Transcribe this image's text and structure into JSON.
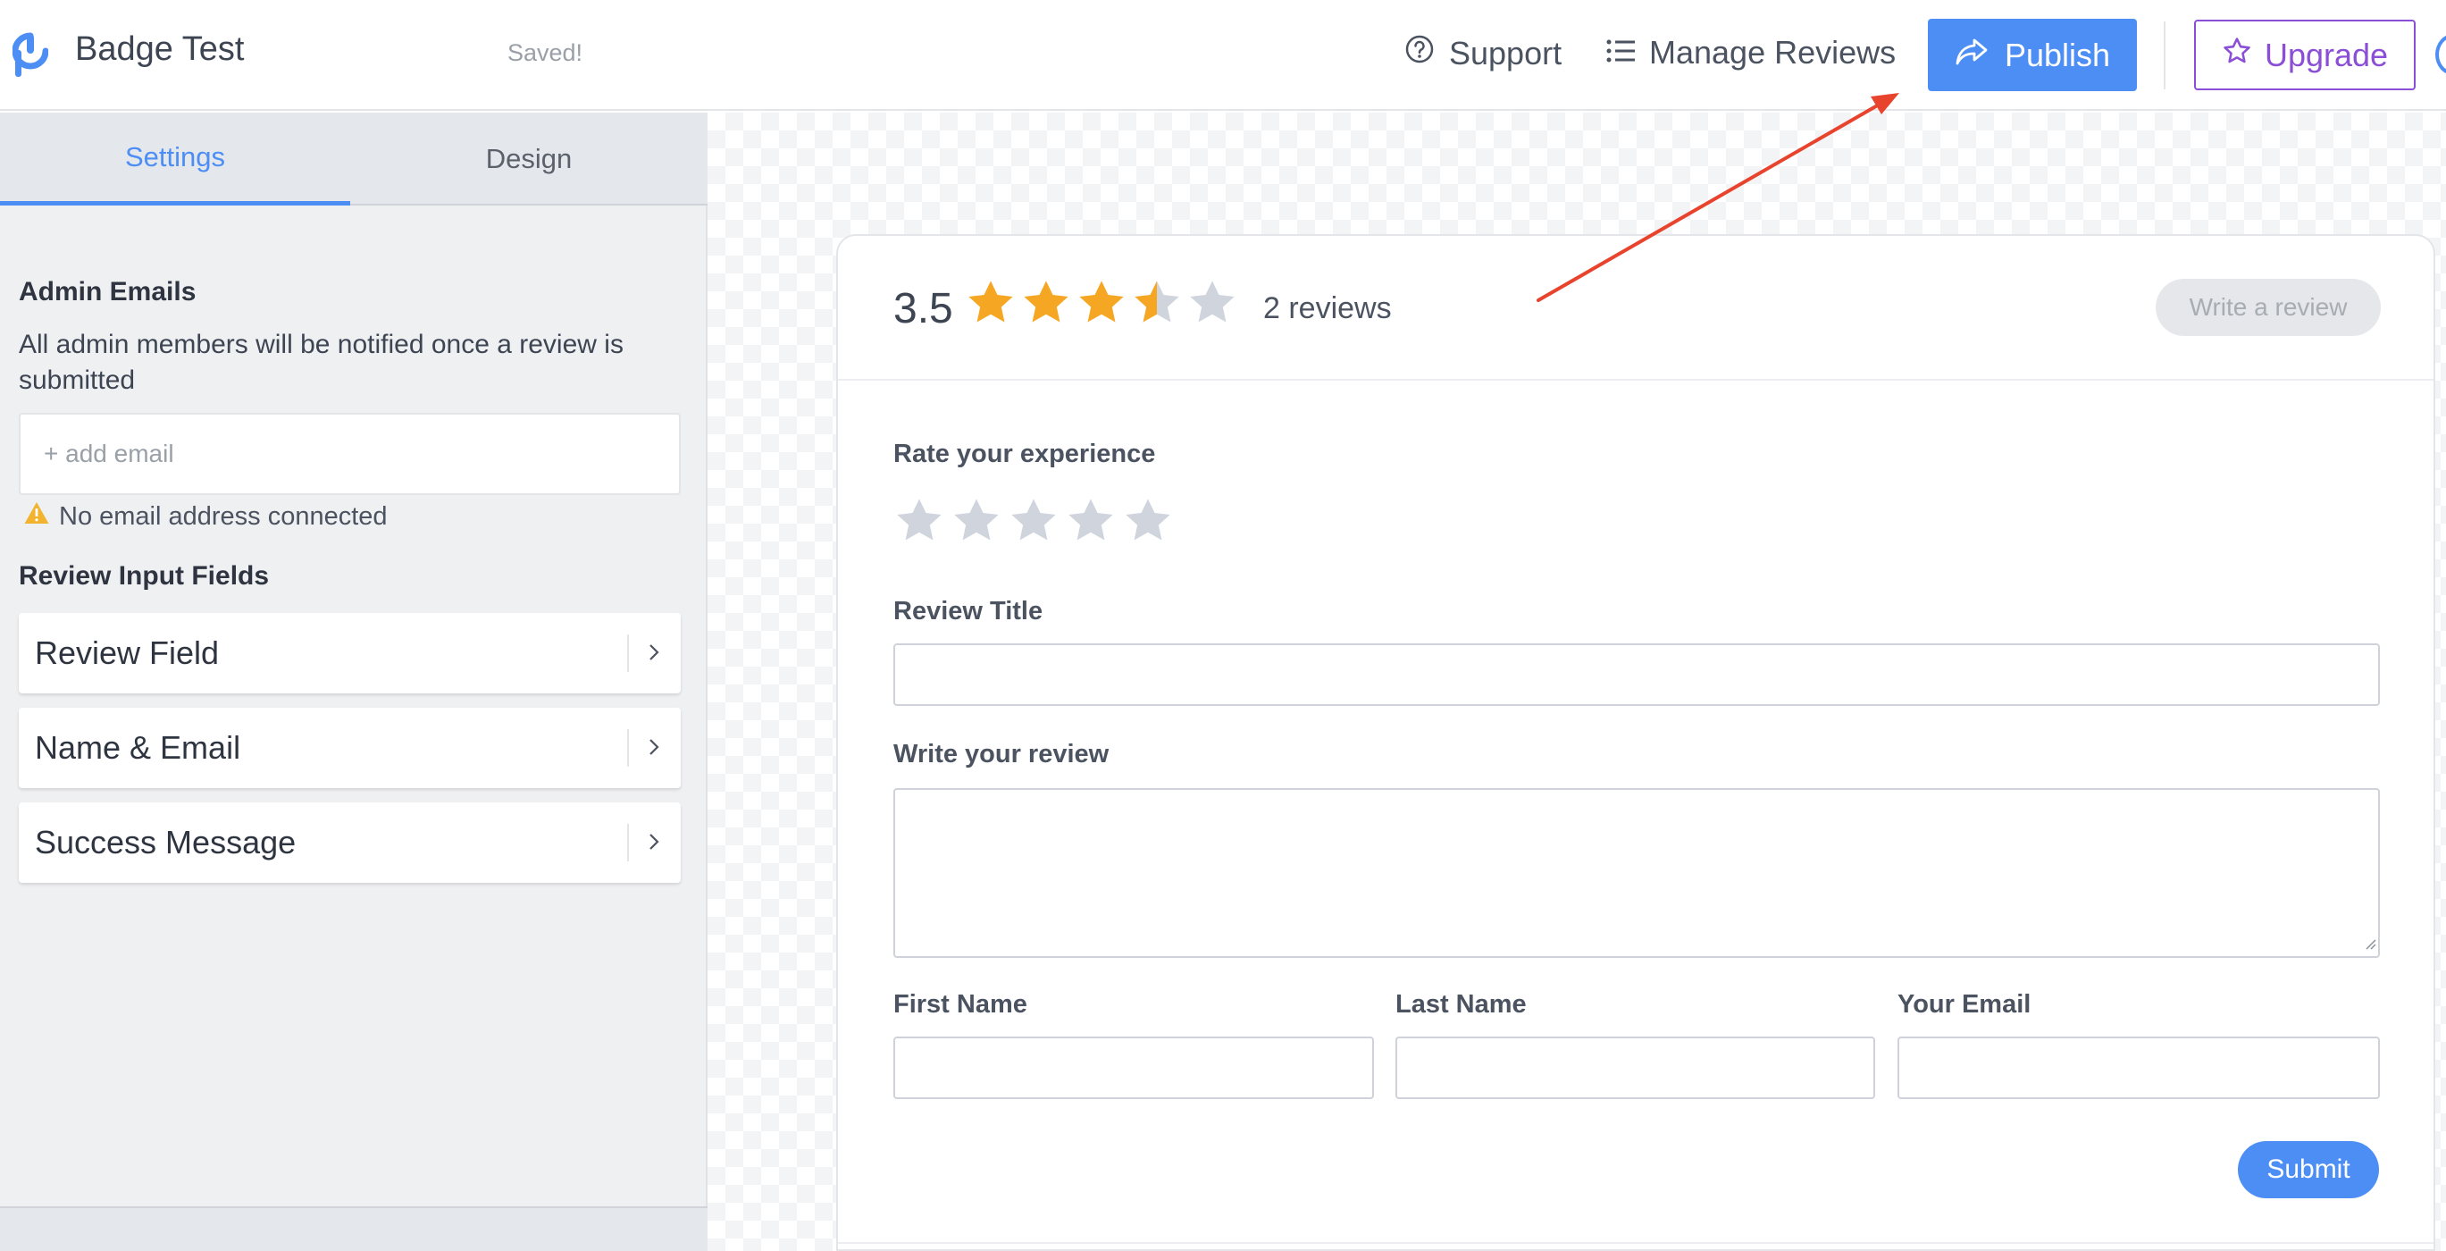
{
  "header": {
    "app_title": "Badge Test",
    "save_status": "Saved!",
    "support_label": "Support",
    "manage_reviews_label": "Manage Reviews",
    "publish_label": "Publish",
    "upgrade_label": "Upgrade"
  },
  "sidebar": {
    "tabs": [
      {
        "label": "Settings",
        "active": true
      },
      {
        "label": "Design",
        "active": false
      }
    ],
    "admin_emails": {
      "title": "Admin Emails",
      "description": "All admin members will be notified once a review is submitted",
      "placeholder": "+ add email",
      "warning": "No email address connected"
    },
    "review_input_fields": {
      "title": "Review Input Fields",
      "items": [
        {
          "label": "Review Field"
        },
        {
          "label": "Name & Email"
        },
        {
          "label": "Success Message"
        }
      ]
    }
  },
  "widget": {
    "average_rating": "3.5",
    "rating_value": 3.5,
    "rating_max": 5,
    "review_count": "2 reviews",
    "write_review_label": "Write a review",
    "form": {
      "rate_label": "Rate your experience",
      "rate_value": 0,
      "title_label": "Review Title",
      "review_label": "Write your review",
      "first_name_label": "First Name",
      "last_name_label": "Last Name",
      "email_label": "Your Email",
      "submit_label": "Submit"
    }
  },
  "colors": {
    "accent": "#4d8ef5",
    "upgrade": "#8a4fd6",
    "star_filled": "#f5a623",
    "star_empty": "#cfd4dd",
    "annotation_arrow": "#e8432c"
  }
}
